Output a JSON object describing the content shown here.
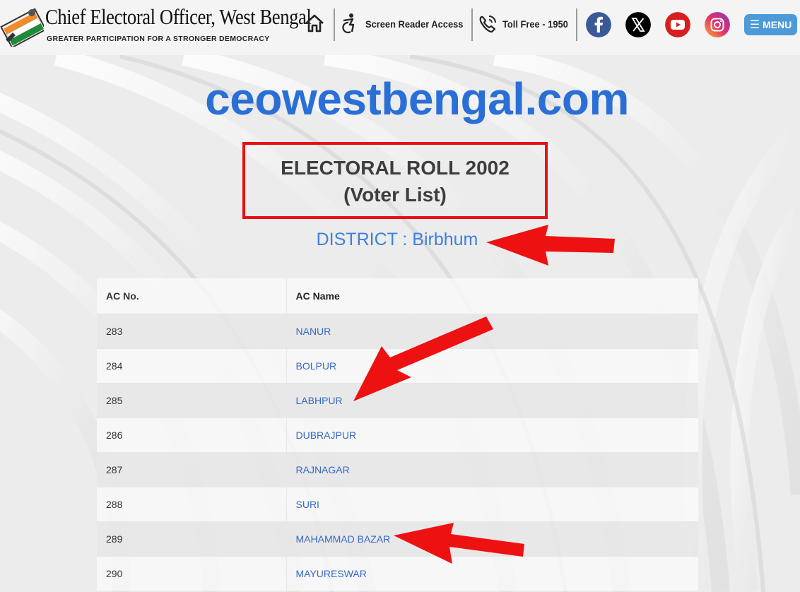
{
  "header": {
    "brand_title": "Chief Electoral Officer, West Bengal",
    "brand_tagline": "GREATER PARTICIPATION FOR A STRONGER DEMOCRACY",
    "home_icon": "home-icon",
    "screen_reader_label": "Screen Reader Access",
    "toll_free_label": "Toll Free - 1950",
    "socials": [
      "facebook-icon",
      "x-icon",
      "youtube-icon",
      "instagram-icon"
    ],
    "menu_icon": "☰",
    "menu_label": "MENU"
  },
  "main": {
    "site_name": "ceowestbengal.com",
    "roll_title_line1": "ELECTORAL ROLL 2002",
    "roll_title_line2": "(Voter List)",
    "district_label": "DISTRICT : Birbhum"
  },
  "table": {
    "headers": [
      "AC No.",
      "AC Name"
    ],
    "rows": [
      {
        "no": "283",
        "name": "NANUR"
      },
      {
        "no": "284",
        "name": "BOLPUR"
      },
      {
        "no": "285",
        "name": "LABHPUR"
      },
      {
        "no": "286",
        "name": "DUBRAJPUR"
      },
      {
        "no": "287",
        "name": "RAJNAGAR"
      },
      {
        "no": "288",
        "name": "SURI"
      },
      {
        "no": "289",
        "name": "MAHAMMAD BAZAR"
      },
      {
        "no": "290",
        "name": "MAYURESWAR"
      }
    ]
  },
  "colors": {
    "brand_blue": "#2a6fd6",
    "link_blue": "#3568c9",
    "highlight_red": "#e81010",
    "menu_blue": "#4d9ad8"
  }
}
